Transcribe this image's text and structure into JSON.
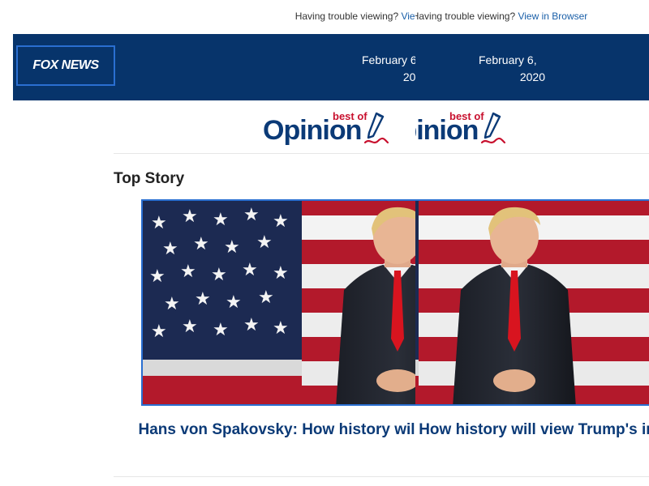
{
  "banner": {
    "trouble_text": "Having trouble viewing?",
    "view_browser_link": "View in Browser"
  },
  "header": {
    "logo_text": "FOX NEWS",
    "date_line1": "February 6,",
    "date_line2": "2020"
  },
  "brand": {
    "best_of": "best of",
    "opinion": "Opinion"
  },
  "top_story": {
    "section_title": "Top Story",
    "headline": "Hans von Spakovsky: How history will view Trump's impeachment",
    "image": "photo-trump-flag"
  },
  "colors": {
    "header_bg": "#07346b",
    "link": "#1a5fa8",
    "brand_red": "#c8102e",
    "brand_blue": "#0b3a77",
    "photo_border": "#2a6fd1"
  }
}
